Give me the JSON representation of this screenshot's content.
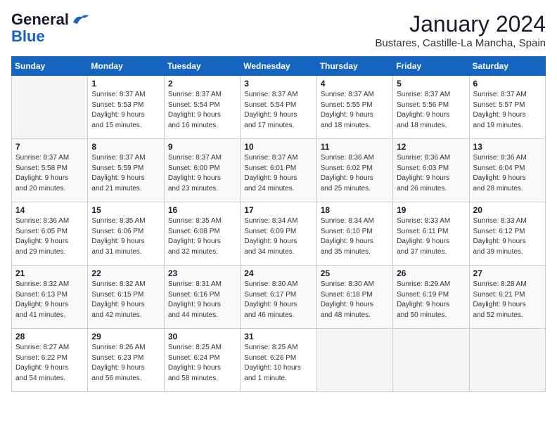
{
  "header": {
    "logo_general": "General",
    "logo_blue": "Blue",
    "month": "January 2024",
    "location": "Bustares, Castille-La Mancha, Spain"
  },
  "columns": [
    "Sunday",
    "Monday",
    "Tuesday",
    "Wednesday",
    "Thursday",
    "Friday",
    "Saturday"
  ],
  "weeks": [
    [
      {
        "day": "",
        "info": ""
      },
      {
        "day": "1",
        "info": "Sunrise: 8:37 AM\nSunset: 5:53 PM\nDaylight: 9 hours\nand 15 minutes."
      },
      {
        "day": "2",
        "info": "Sunrise: 8:37 AM\nSunset: 5:54 PM\nDaylight: 9 hours\nand 16 minutes."
      },
      {
        "day": "3",
        "info": "Sunrise: 8:37 AM\nSunset: 5:54 PM\nDaylight: 9 hours\nand 17 minutes."
      },
      {
        "day": "4",
        "info": "Sunrise: 8:37 AM\nSunset: 5:55 PM\nDaylight: 9 hours\nand 18 minutes."
      },
      {
        "day": "5",
        "info": "Sunrise: 8:37 AM\nSunset: 5:56 PM\nDaylight: 9 hours\nand 18 minutes."
      },
      {
        "day": "6",
        "info": "Sunrise: 8:37 AM\nSunset: 5:57 PM\nDaylight: 9 hours\nand 19 minutes."
      }
    ],
    [
      {
        "day": "7",
        "info": "Sunrise: 8:37 AM\nSunset: 5:58 PM\nDaylight: 9 hours\nand 20 minutes."
      },
      {
        "day": "8",
        "info": "Sunrise: 8:37 AM\nSunset: 5:59 PM\nDaylight: 9 hours\nand 21 minutes."
      },
      {
        "day": "9",
        "info": "Sunrise: 8:37 AM\nSunset: 6:00 PM\nDaylight: 9 hours\nand 23 minutes."
      },
      {
        "day": "10",
        "info": "Sunrise: 8:37 AM\nSunset: 6:01 PM\nDaylight: 9 hours\nand 24 minutes."
      },
      {
        "day": "11",
        "info": "Sunrise: 8:36 AM\nSunset: 6:02 PM\nDaylight: 9 hours\nand 25 minutes."
      },
      {
        "day": "12",
        "info": "Sunrise: 8:36 AM\nSunset: 6:03 PM\nDaylight: 9 hours\nand 26 minutes."
      },
      {
        "day": "13",
        "info": "Sunrise: 8:36 AM\nSunset: 6:04 PM\nDaylight: 9 hours\nand 28 minutes."
      }
    ],
    [
      {
        "day": "14",
        "info": "Sunrise: 8:36 AM\nSunset: 6:05 PM\nDaylight: 9 hours\nand 29 minutes."
      },
      {
        "day": "15",
        "info": "Sunrise: 8:35 AM\nSunset: 6:06 PM\nDaylight: 9 hours\nand 31 minutes."
      },
      {
        "day": "16",
        "info": "Sunrise: 8:35 AM\nSunset: 6:08 PM\nDaylight: 9 hours\nand 32 minutes."
      },
      {
        "day": "17",
        "info": "Sunrise: 8:34 AM\nSunset: 6:09 PM\nDaylight: 9 hours\nand 34 minutes."
      },
      {
        "day": "18",
        "info": "Sunrise: 8:34 AM\nSunset: 6:10 PM\nDaylight: 9 hours\nand 35 minutes."
      },
      {
        "day": "19",
        "info": "Sunrise: 8:33 AM\nSunset: 6:11 PM\nDaylight: 9 hours\nand 37 minutes."
      },
      {
        "day": "20",
        "info": "Sunrise: 8:33 AM\nSunset: 6:12 PM\nDaylight: 9 hours\nand 39 minutes."
      }
    ],
    [
      {
        "day": "21",
        "info": "Sunrise: 8:32 AM\nSunset: 6:13 PM\nDaylight: 9 hours\nand 41 minutes."
      },
      {
        "day": "22",
        "info": "Sunrise: 8:32 AM\nSunset: 6:15 PM\nDaylight: 9 hours\nand 42 minutes."
      },
      {
        "day": "23",
        "info": "Sunrise: 8:31 AM\nSunset: 6:16 PM\nDaylight: 9 hours\nand 44 minutes."
      },
      {
        "day": "24",
        "info": "Sunrise: 8:30 AM\nSunset: 6:17 PM\nDaylight: 9 hours\nand 46 minutes."
      },
      {
        "day": "25",
        "info": "Sunrise: 8:30 AM\nSunset: 6:18 PM\nDaylight: 9 hours\nand 48 minutes."
      },
      {
        "day": "26",
        "info": "Sunrise: 8:29 AM\nSunset: 6:19 PM\nDaylight: 9 hours\nand 50 minutes."
      },
      {
        "day": "27",
        "info": "Sunrise: 8:28 AM\nSunset: 6:21 PM\nDaylight: 9 hours\nand 52 minutes."
      }
    ],
    [
      {
        "day": "28",
        "info": "Sunrise: 8:27 AM\nSunset: 6:22 PM\nDaylight: 9 hours\nand 54 minutes."
      },
      {
        "day": "29",
        "info": "Sunrise: 8:26 AM\nSunset: 6:23 PM\nDaylight: 9 hours\nand 56 minutes."
      },
      {
        "day": "30",
        "info": "Sunrise: 8:25 AM\nSunset: 6:24 PM\nDaylight: 9 hours\nand 58 minutes."
      },
      {
        "day": "31",
        "info": "Sunrise: 8:25 AM\nSunset: 6:26 PM\nDaylight: 10 hours\nand 1 minute."
      },
      {
        "day": "",
        "info": ""
      },
      {
        "day": "",
        "info": ""
      },
      {
        "day": "",
        "info": ""
      }
    ]
  ]
}
